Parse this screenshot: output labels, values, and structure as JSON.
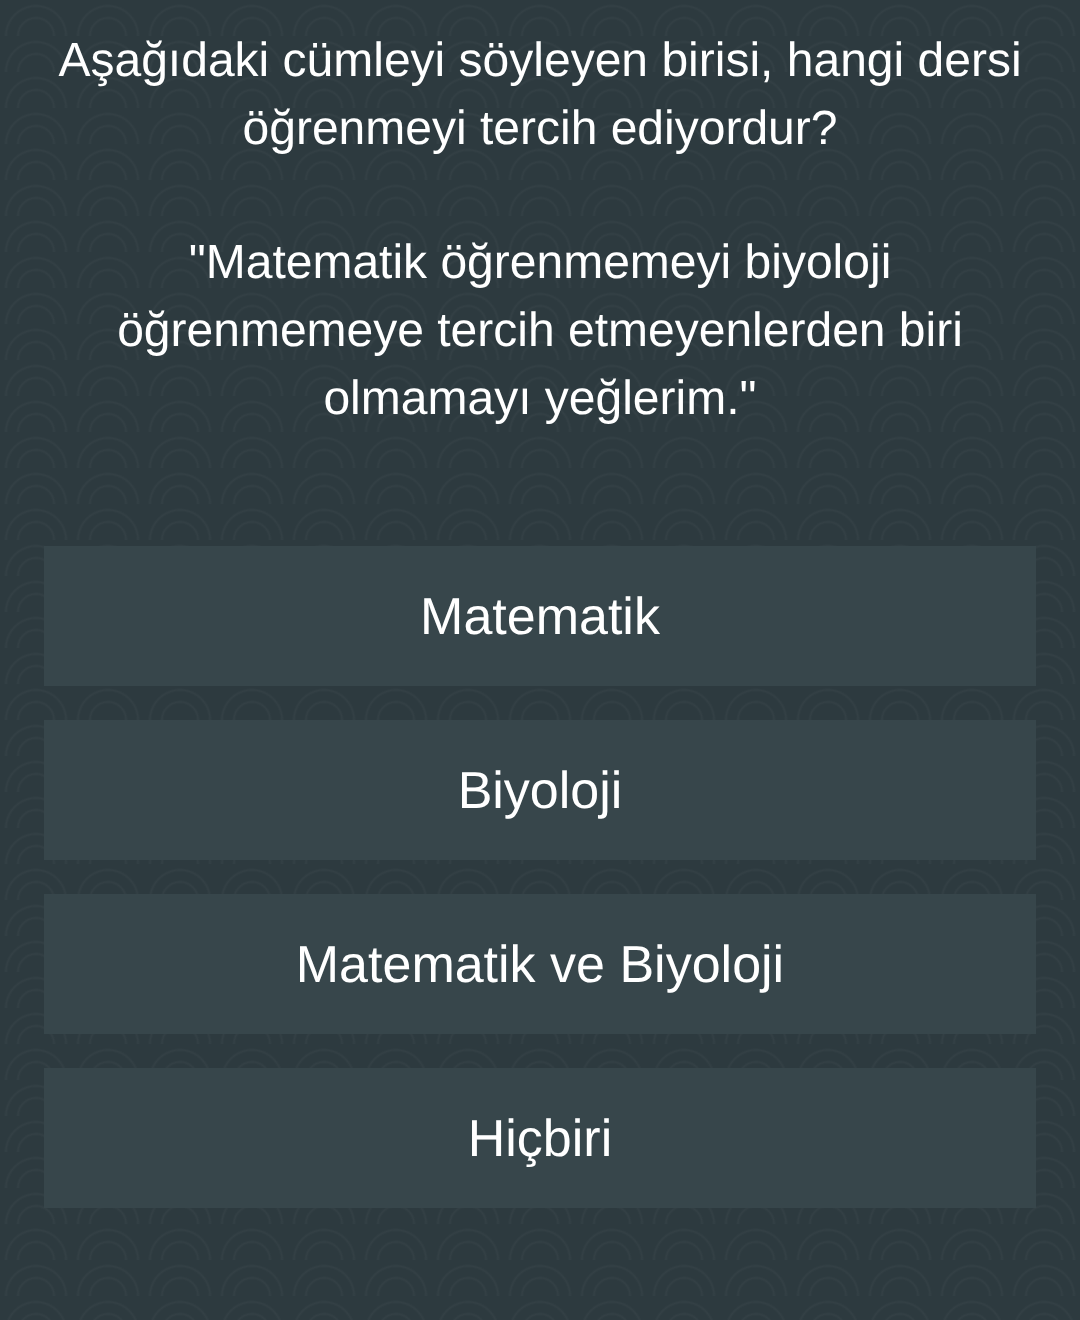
{
  "question": "Aşağıdaki cümleyi söyleyen birisi, hangi dersi öğrenmeyi tercih ediyordur?",
  "quote": "\"Matematik öğrenmemeyi biyoloji öğrenmemeye tercih etmeyenlerden biri olmamayı yeğlerim.\"",
  "answers": [
    {
      "label": "Matematik"
    },
    {
      "label": "Biyoloji"
    },
    {
      "label": "Matematik ve Biyoloji"
    },
    {
      "label": "Hiçbiri"
    }
  ]
}
